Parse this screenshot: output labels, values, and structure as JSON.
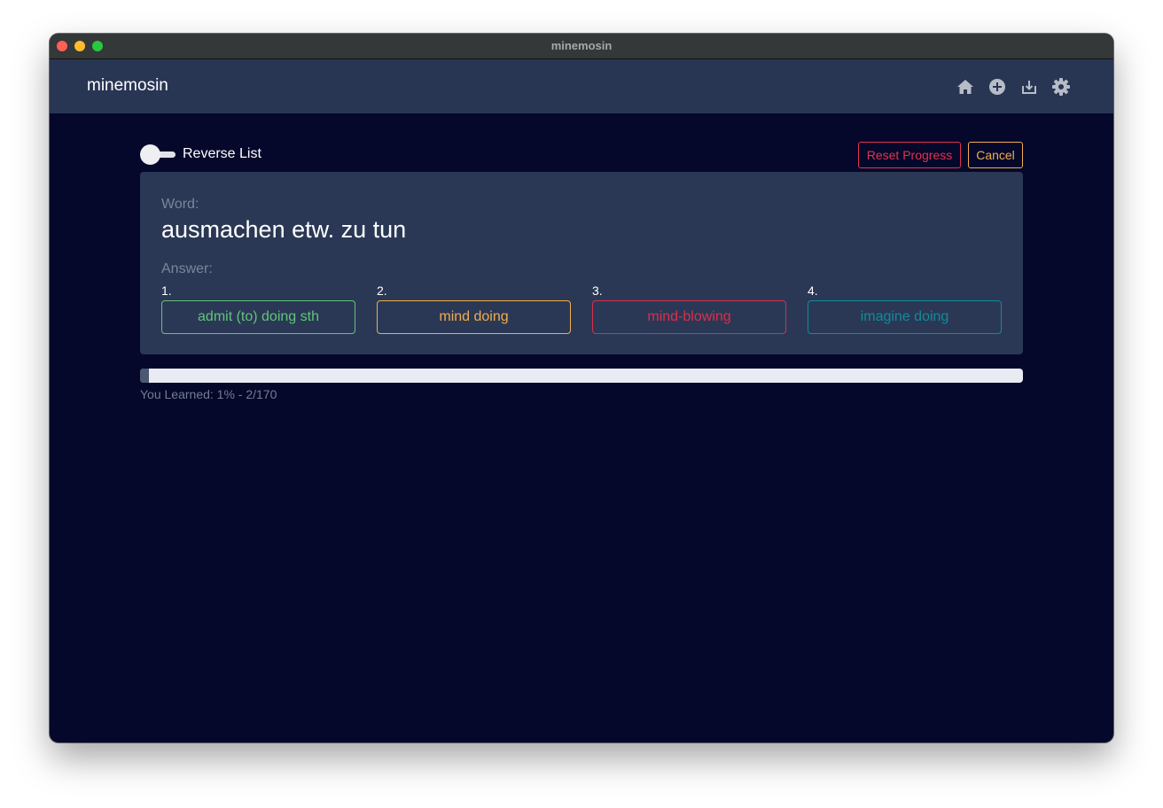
{
  "window": {
    "title": "minemosin"
  },
  "navbar": {
    "brand": "minemosin",
    "icons": [
      "home-icon",
      "add-circle-icon",
      "download-icon",
      "gear-icon"
    ]
  },
  "toolbar": {
    "toggle_label": "Reverse List",
    "toggle_on": false,
    "reset_label": "Reset Progress",
    "cancel_label": "Cancel"
  },
  "card": {
    "word_label": "Word:",
    "word": "ausmachen etw. zu tun",
    "answer_label": "Answer:",
    "answers": [
      {
        "num": "1.",
        "text": "admit (to) doing sth",
        "color": "#62c47a"
      },
      {
        "num": "2.",
        "text": "mind doing",
        "color": "#f0ad4e"
      },
      {
        "num": "3.",
        "text": "mind-blowing",
        "color": "#d9304b"
      },
      {
        "num": "4.",
        "text": "imagine doing",
        "color": "#138b9a"
      }
    ]
  },
  "progress": {
    "fraction": 0.01,
    "text": "You Learned: 1% - 2/170"
  },
  "colors": {
    "background": "#05082b",
    "navbar": "#283654",
    "card": "#2a3855",
    "danger": "#e0334f",
    "warning": "#f0ad4e"
  }
}
